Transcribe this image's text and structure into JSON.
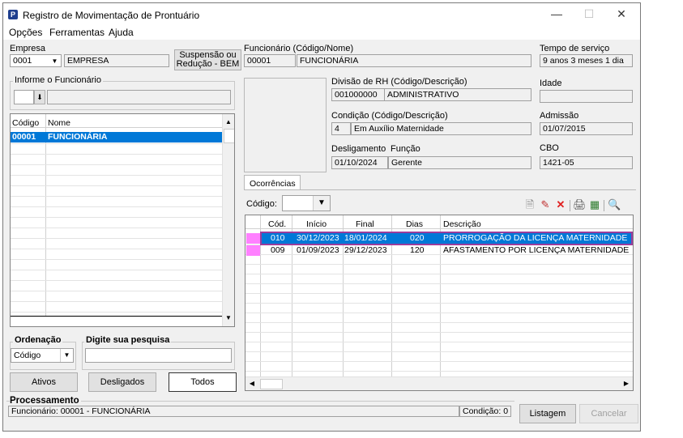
{
  "window": {
    "title": "Registro de Movimentação de Prontuário"
  },
  "menu": [
    "Opções",
    "Ferramentas",
    "Ajuda"
  ],
  "empresa": {
    "label": "Empresa",
    "code": "0001",
    "name": "EMPRESA"
  },
  "suspensao_button": {
    "line1": "Suspensão ou",
    "line2": "Redução - BEM"
  },
  "funcionario": {
    "label": "Funcionário (Código/Nome)",
    "code": "00001",
    "name": "FUNCIONÁRIA"
  },
  "tempo_servico": {
    "label": "Tempo de serviço",
    "value": "9 anos 3 meses 1 dia"
  },
  "informe": {
    "label": "Informe o Funcionário"
  },
  "employee_list": {
    "headers": [
      "Código",
      "Nome"
    ],
    "rows": [
      {
        "code": "00001",
        "name": "FUNCIONÁRIA"
      }
    ]
  },
  "divisao": {
    "label": "Divisão de RH (Código/Descrição)",
    "code": "001000000",
    "desc": "ADMINISTRATIVO"
  },
  "idade": {
    "label": "Idade",
    "value": ""
  },
  "condicao": {
    "label": "Condição (Código/Descrição)",
    "code": "4",
    "desc": "Em Auxílio Maternidade"
  },
  "admissao": {
    "label": "Admissão",
    "value": "01/07/2015"
  },
  "desligamento": {
    "label": "Desligamento",
    "value": "01/10/2024"
  },
  "funcao": {
    "label": "Função",
    "value": "Gerente"
  },
  "cbo": {
    "label": "CBO",
    "value": "1421-05"
  },
  "ocorrencias": {
    "tab": "Ocorrências",
    "codigo_label": "Código:",
    "headers": [
      "Cód.",
      "Início",
      "Final",
      "Dias",
      "Descrição"
    ],
    "rows": [
      {
        "cod": "010",
        "inicio": "30/12/2023",
        "final": "18/01/2024",
        "dias": "020",
        "desc": "PRORROGAÇÃO DA LICENÇA MATERNIDADE",
        "selected": true
      },
      {
        "cod": "009",
        "inicio": "01/09/2023",
        "final": "29/12/2023",
        "dias": "120",
        "desc": "AFASTAMENTO POR LICENÇA MATERNIDADE",
        "selected": false
      }
    ],
    "marker_color": "#ff80ff",
    "selection_color": "#0078d7"
  },
  "ordenacao": {
    "label": "Ordenação",
    "value": "Código"
  },
  "pesquisa": {
    "label": "Digite sua pesquisa",
    "value": ""
  },
  "filter_buttons": {
    "ativos": "Ativos",
    "desligados": "Desligados",
    "todos": "Todos"
  },
  "processamento": {
    "label": "Processamento",
    "status": "Funcionário: 00001 - FUNCIONÁRIA",
    "condicao": "Condição: 0"
  },
  "actions": {
    "listagem": "Listagem",
    "cancelar": "Cancelar"
  }
}
